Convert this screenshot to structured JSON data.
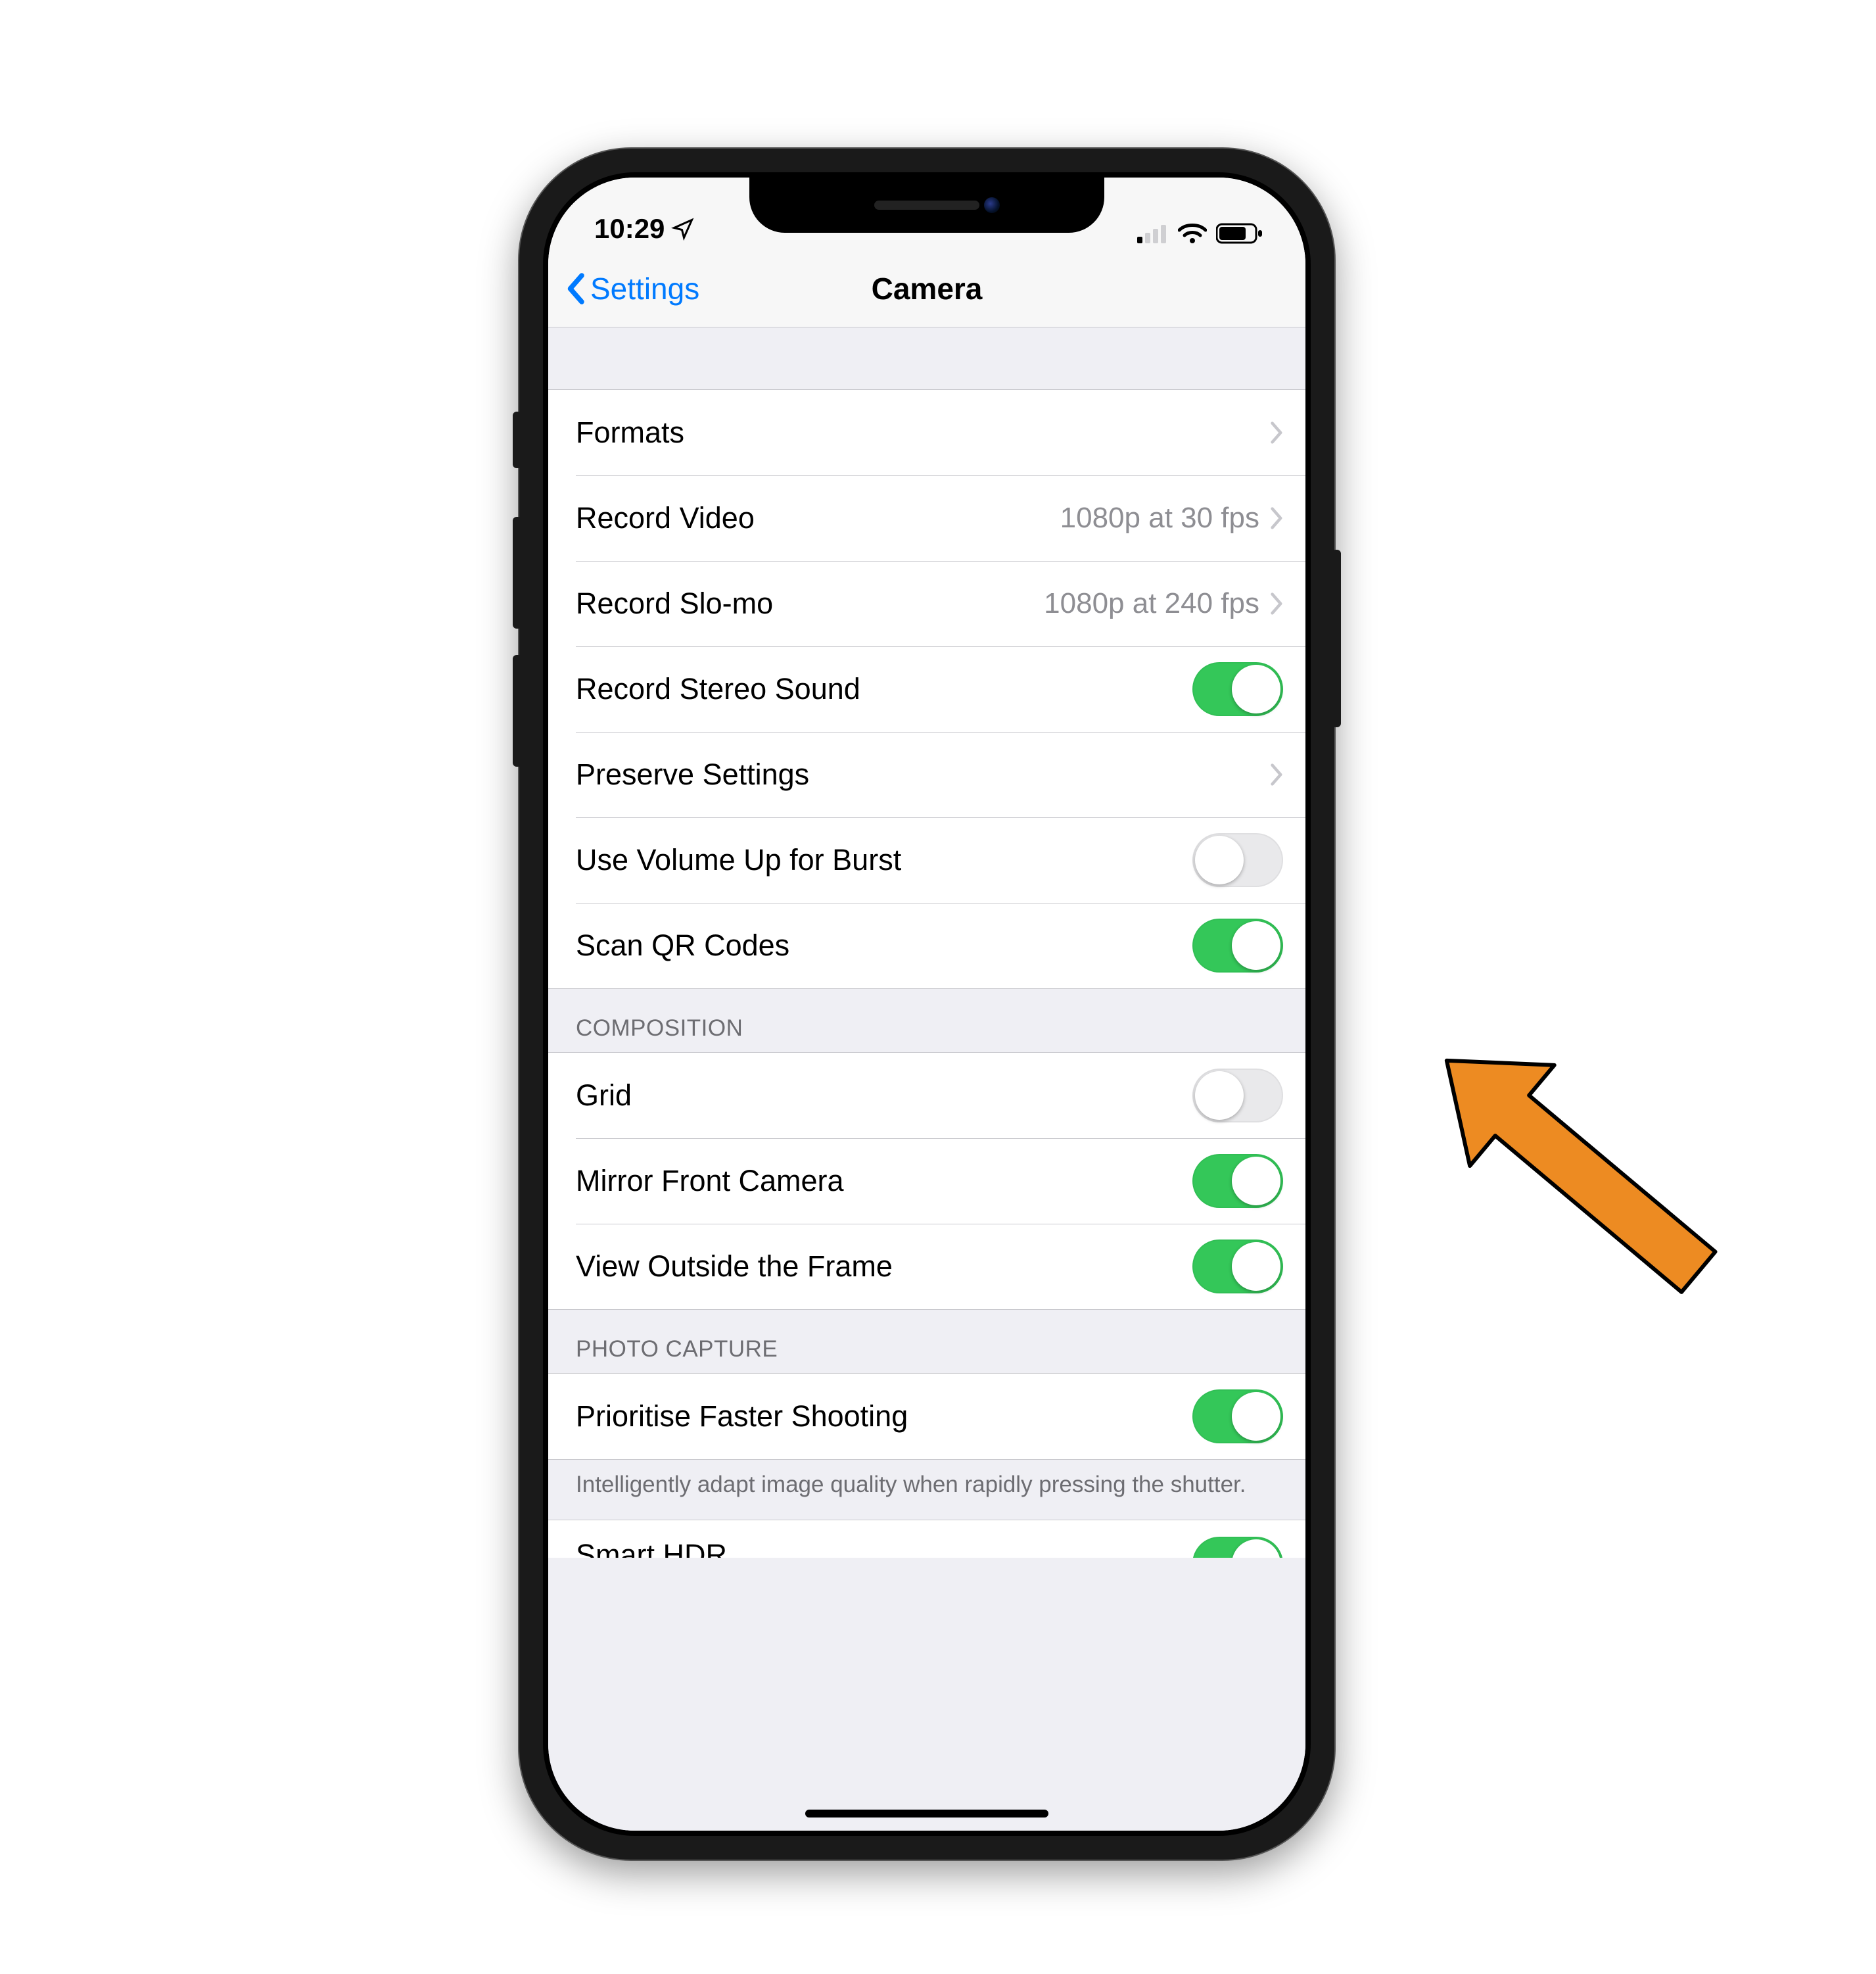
{
  "status": {
    "time": "10:29",
    "location_icon": "location-arrow",
    "cell_bars": 1,
    "wifi_bars": 3,
    "battery_pct": 70
  },
  "nav": {
    "back_label": "Settings",
    "title": "Camera"
  },
  "sections": {
    "main": [
      {
        "key": "formats",
        "label": "Formats",
        "type": "disclosure"
      },
      {
        "key": "record_video",
        "label": "Record Video",
        "type": "disclosure",
        "value": "1080p at 30 fps"
      },
      {
        "key": "record_slomo",
        "label": "Record Slo-mo",
        "type": "disclosure",
        "value": "1080p at 240 fps"
      },
      {
        "key": "stereo_sound",
        "label": "Record Stereo Sound",
        "type": "toggle",
        "on": true
      },
      {
        "key": "preserve",
        "label": "Preserve Settings",
        "type": "disclosure"
      },
      {
        "key": "volume_burst",
        "label": "Use Volume Up for Burst",
        "type": "toggle",
        "on": false
      },
      {
        "key": "scan_qr",
        "label": "Scan QR Codes",
        "type": "toggle",
        "on": true
      }
    ],
    "composition_header": "COMPOSITION",
    "composition": [
      {
        "key": "grid",
        "label": "Grid",
        "type": "toggle",
        "on": false
      },
      {
        "key": "mirror_front",
        "label": "Mirror Front Camera",
        "type": "toggle",
        "on": true
      },
      {
        "key": "view_outside",
        "label": "View Outside the Frame",
        "type": "toggle",
        "on": true
      }
    ],
    "photo_capture_header": "PHOTO CAPTURE",
    "photo_capture": [
      {
        "key": "faster_shooting",
        "label": "Prioritise Faster Shooting",
        "type": "toggle",
        "on": true
      }
    ],
    "photo_capture_footer": "Intelligently adapt image quality when rapidly pressing the shutter.",
    "partial": {
      "label": "Smart HDR",
      "on": true
    }
  },
  "annotation": {
    "arrow_color": "#ED8B22",
    "points_to": "mirror_front"
  }
}
